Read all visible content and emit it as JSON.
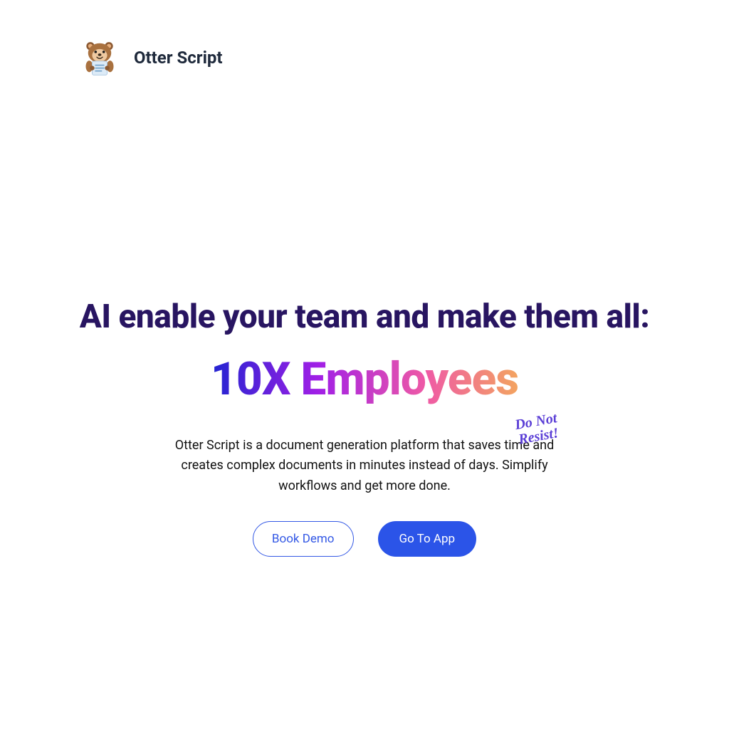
{
  "header": {
    "brand": "Otter Script"
  },
  "hero": {
    "headline": "AI enable your team and make them all:",
    "subhead": "10X Employees",
    "scribble_line1": "Do Not",
    "scribble_line2": "Resist!",
    "description": "Otter Script is a document generation platform that saves time and creates complex documents in minutes instead of days. Simplify workflows and get more done.",
    "cta_primary": "Book Demo",
    "cta_secondary": "Go To App"
  }
}
